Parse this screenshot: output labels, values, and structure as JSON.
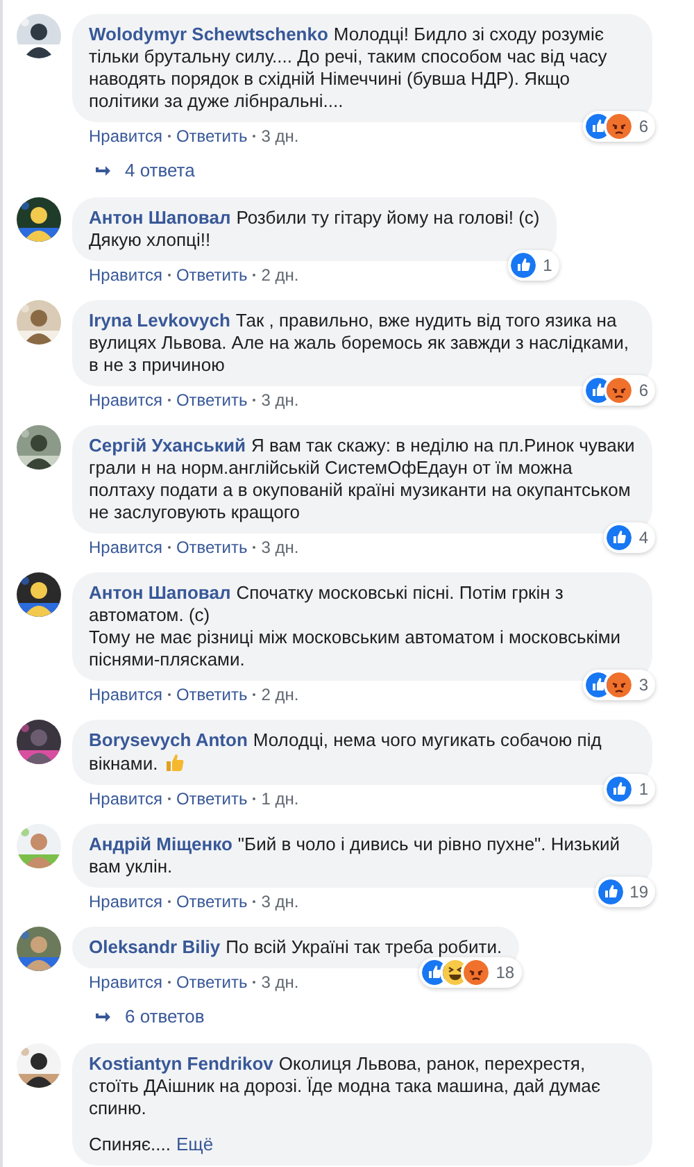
{
  "comments": [
    {
      "author": "Wolodymyr Schewtschenko",
      "paragraphs": [
        "Молодці! Бидло зі сходу розуміє тільки брутальну силу.... До речі, таким способом час від часу наводять порядок в східній Німеччині (бувша НДР). Якщо політики за дуже лібнральні...."
      ],
      "reactions": [
        {
          "kind": "like"
        },
        {
          "kind": "angry"
        }
      ],
      "reaction_count": "6",
      "actions": [
        "Нравится",
        "Ответить",
        "3 дн."
      ],
      "replies": "4 ответа"
    },
    {
      "author": "Антон Шаповал",
      "paragraphs": [
        "Розбили ту гітару йому на голові! (с)\nДякую хлопці!!"
      ],
      "reactions": [
        {
          "kind": "like"
        }
      ],
      "reaction_count": "1",
      "actions": [
        "Нравится",
        "Ответить",
        "2 дн."
      ]
    },
    {
      "author": "Iryna Levkovych",
      "paragraphs": [
        "Так , правильно, вже нудить від того язика на вулицях Львова. Але на жаль боремось як завжди з наслідками, в не з причиною"
      ],
      "reactions": [
        {
          "kind": "like"
        },
        {
          "kind": "angry"
        }
      ],
      "reaction_count": "6",
      "actions": [
        "Нравится",
        "Ответить",
        "3 дн."
      ]
    },
    {
      "author": "Сергій Уханський",
      "paragraphs": [
        "Я вам так скажу: в неділю на пл.Ринок чуваки грали н на норм.англійській СистемОфЕдаун от їм можна полтаху подати а в окупованій країні музиканти на окупантськом не заслуговують кращого"
      ],
      "reactions": [
        {
          "kind": "like"
        }
      ],
      "reaction_count": "4",
      "actions": [
        "Нравится",
        "Ответить",
        "3 дн."
      ]
    },
    {
      "author": "Антон Шаповал",
      "paragraphs": [
        "Спочатку московські пісні. Потім гркін з автоматом. (с)\nТому не має різниці між московським автоматом і московськіми піснями-плясками."
      ],
      "reactions": [
        {
          "kind": "like"
        },
        {
          "kind": "angry"
        }
      ],
      "reaction_count": "3",
      "actions": [
        "Нравится",
        "Ответить",
        "2 дн."
      ]
    },
    {
      "author": "Borysevych Anton",
      "paragraphs": [
        "Молодці, нема чого мугикать собачою під вікнами."
      ],
      "trailing_emoji": {
        "kind": "thumbs_up"
      },
      "reactions": [
        {
          "kind": "like"
        }
      ],
      "reaction_count": "1",
      "actions": [
        "Нравится",
        "Ответить",
        "1 дн."
      ]
    },
    {
      "author": "Андрій Міщенко",
      "paragraphs": [
        "\"Бий в чоло і дивись чи рівно пухне\". Низький вам уклін."
      ],
      "reactions": [
        {
          "kind": "like"
        }
      ],
      "reaction_count": "19",
      "actions": [
        "Нравится",
        "Ответить",
        "3 дн."
      ]
    },
    {
      "author": "Oleksandr Biliy",
      "paragraphs": [
        "По всій Україні так треба робити."
      ],
      "reactions": [
        {
          "kind": "like"
        },
        {
          "kind": "haha"
        },
        {
          "kind": "angry"
        }
      ],
      "reaction_count": "18",
      "actions": [
        "Нравится",
        "Ответить",
        "3 дн."
      ],
      "replies": "6 ответов"
    },
    {
      "author": "Kostiantyn Fendrikov",
      "paragraphs": [
        "Околиця Львова, ранок, перехрестя, стоїть ДАішник на дорозі. Їде модна така машина, дай думає спиню.",
        "Спиняє...."
      ],
      "more_link": "Ещё"
    }
  ]
}
